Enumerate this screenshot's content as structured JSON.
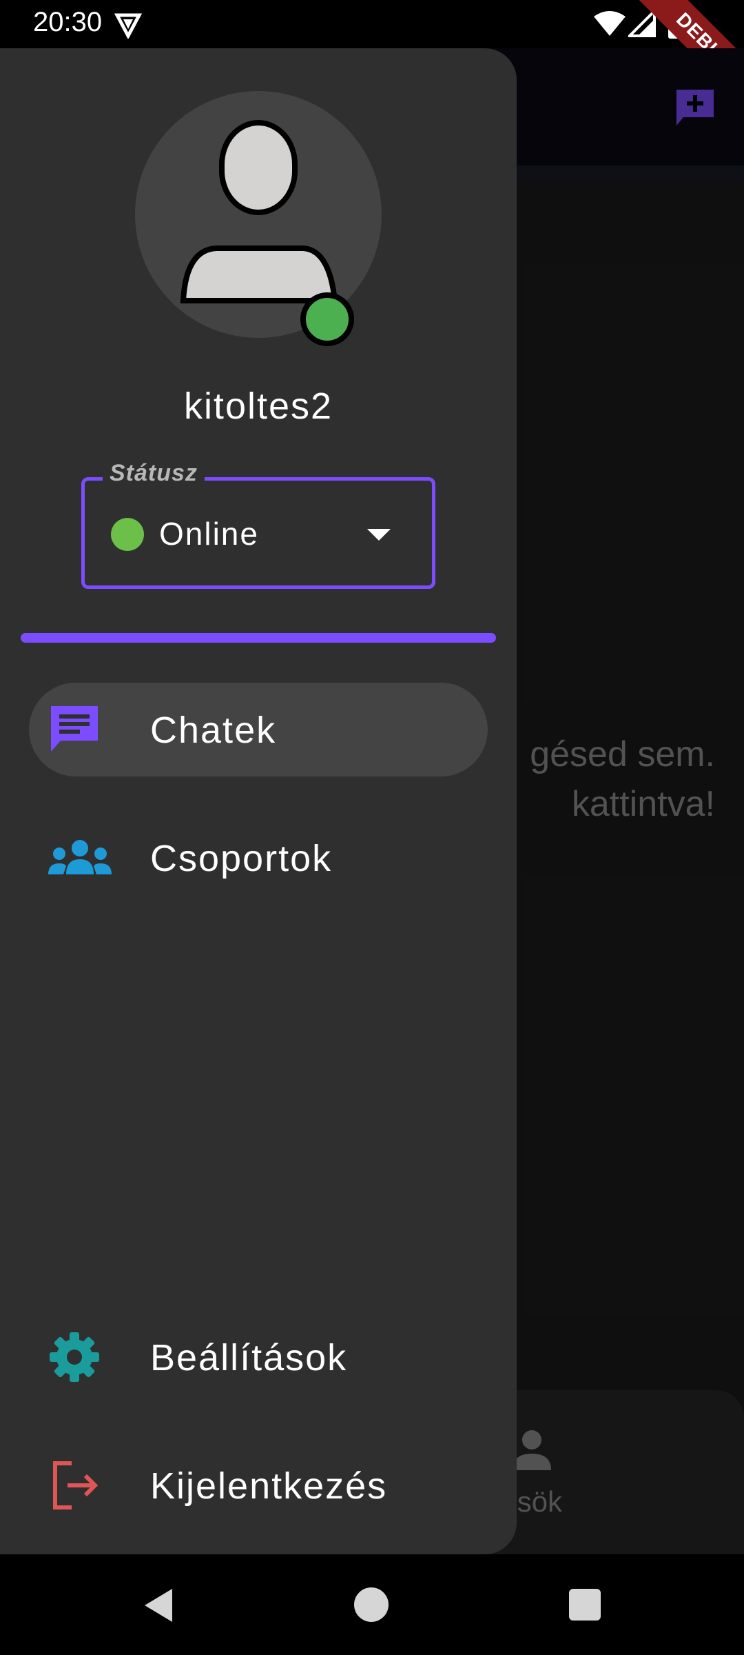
{
  "status_bar": {
    "time": "20:30",
    "debug_label": "DEBUG"
  },
  "background": {
    "empty_text_line1": "gésed sem.",
    "empty_text_line2": "kattintva!",
    "bottom_nav_label": "erősök"
  },
  "drawer": {
    "username": "kitoltes2",
    "status_field_label": "Státusz",
    "status_value": "Online",
    "status_color": "#6cc04a",
    "accent": "#7c4dff",
    "menu": [
      {
        "label": "Chatek",
        "icon": "chat-icon",
        "color": "#7c4dff",
        "active": true
      },
      {
        "label": "Csoportok",
        "icon": "groups-icon",
        "color": "#1e9ad6",
        "active": false
      }
    ],
    "footer": [
      {
        "label": "Beállítások",
        "icon": "gear-icon",
        "color": "#1a9c9c"
      },
      {
        "label": "Kijelentkezés",
        "icon": "logout-icon",
        "color": "#e05555"
      }
    ]
  }
}
